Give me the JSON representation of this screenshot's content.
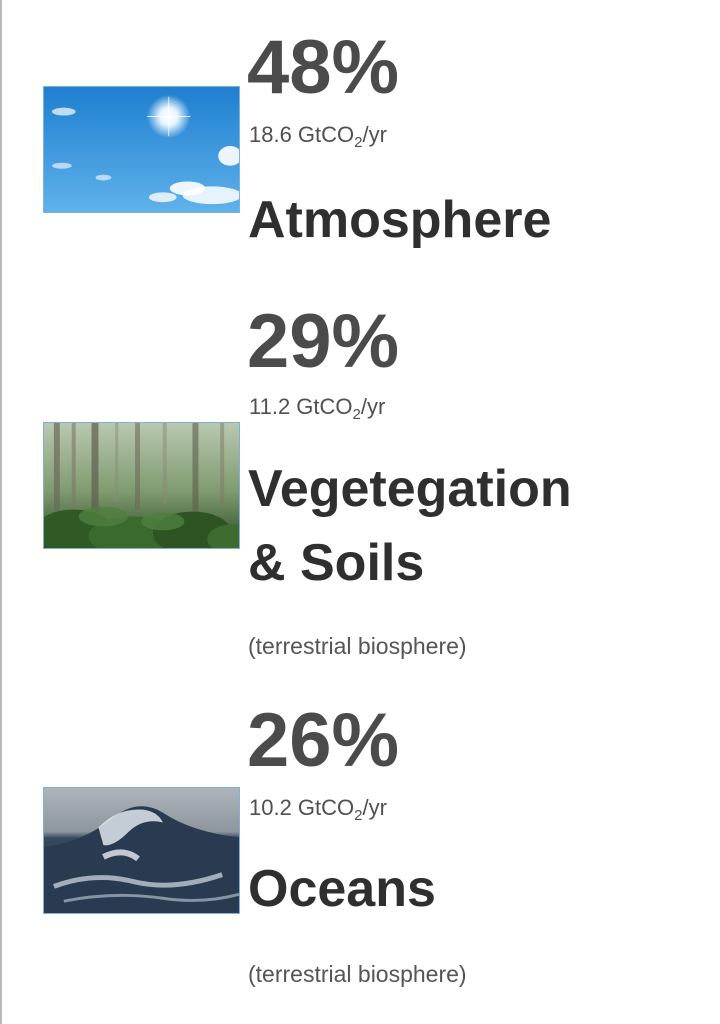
{
  "sinks": [
    {
      "percent": "48%",
      "flux_value": "18.6 GtCO",
      "flux_sub": "2",
      "flux_unit": "/yr",
      "name_line1": "Atmosphere",
      "name_line2": "",
      "note": "",
      "image": "sky-photo"
    },
    {
      "percent": "29%",
      "flux_value": "11.2 GtCO",
      "flux_sub": "2",
      "flux_unit": "/yr",
      "name_line1": "Vegetegation",
      "name_line2": "& Soils",
      "note": "(terrestrial biosphere)",
      "image": "forest-photo"
    },
    {
      "percent": "26%",
      "flux_value": "10.2 GtCO",
      "flux_sub": "2",
      "flux_unit": "/yr",
      "name_line1": "Oceans",
      "name_line2": "",
      "note": "(terrestrial biosphere)",
      "image": "ocean-wave-photo"
    }
  ],
  "colors": {
    "sky": "#2f8fd8",
    "forest": "#3f6b34",
    "ocean": "#1f2f44"
  }
}
